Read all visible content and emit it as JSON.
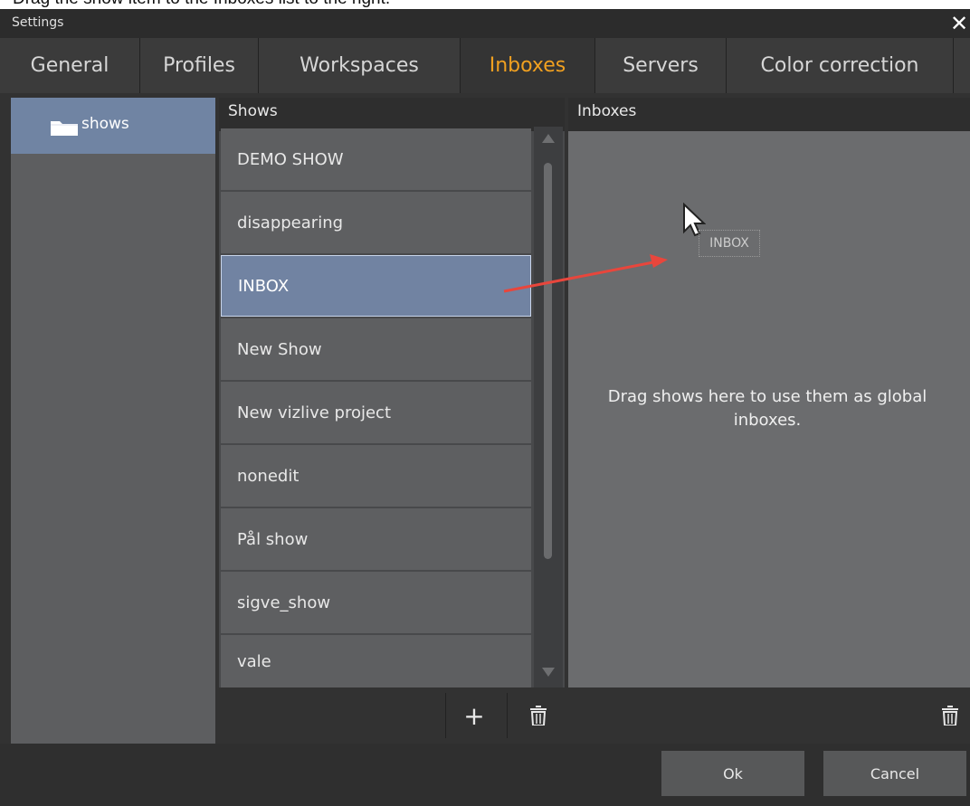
{
  "banner": {
    "text": "Drag the show item to the Inboxes list to the right."
  },
  "window": {
    "title": "Settings",
    "close_glyph": "✕"
  },
  "tabs": [
    {
      "label": "General"
    },
    {
      "label": "Profiles"
    },
    {
      "label": "Workspaces"
    },
    {
      "label": "Inboxes",
      "active": true
    },
    {
      "label": "Servers"
    },
    {
      "label": "Color correction"
    }
  ],
  "tree": {
    "items": [
      {
        "label": "shows",
        "icon": "folder-icon"
      }
    ]
  },
  "shows_panel": {
    "header": "Shows",
    "items": [
      "DEMO SHOW",
      "disappearing",
      "INBOX",
      "New Show",
      "New vizlive project",
      "nonedit",
      "Pål show",
      "sigve_show",
      "vale"
    ],
    "selected": "INBOX",
    "add_glyph": "+",
    "delete_icon": "trash-icon"
  },
  "inboxes_panel": {
    "header": "Inboxes",
    "hint": "Drag shows here to use them as global inboxes.",
    "drag_ghost": "INBOX",
    "delete_icon": "trash-icon"
  },
  "buttons": {
    "ok": "Ok",
    "cancel": "Cancel"
  },
  "colors": {
    "accent": "#f0a020",
    "selection": "#7183a2",
    "annotation_arrow": "#e8463c"
  }
}
